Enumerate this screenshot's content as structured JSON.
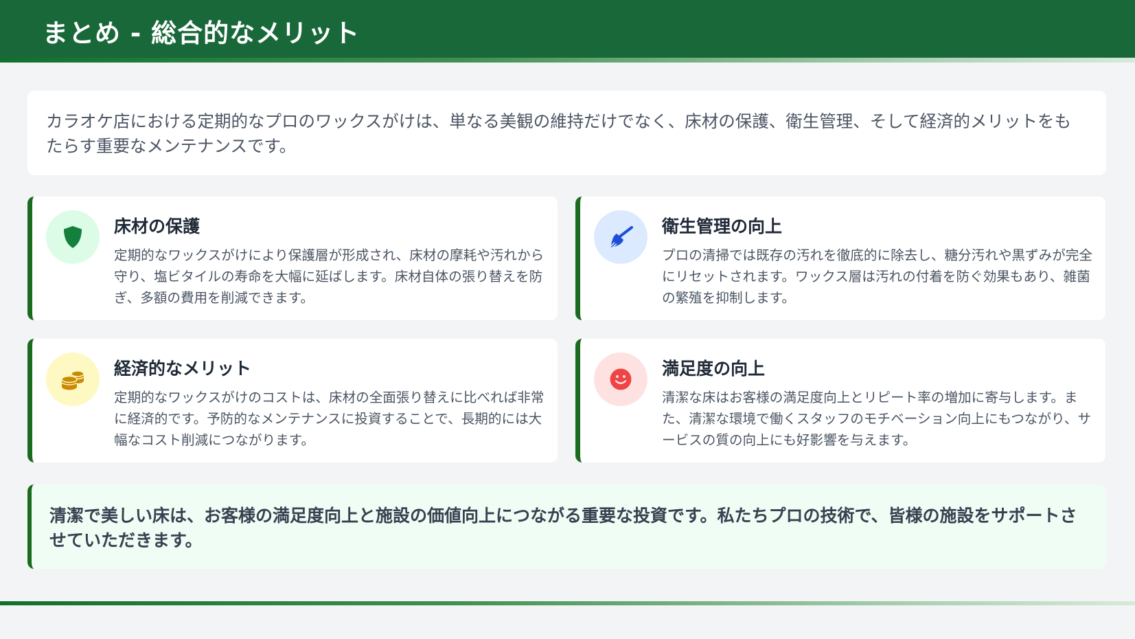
{
  "header": {
    "title": "まとめ - 総合的なメリット"
  },
  "intro": {
    "text": "カラオケ店における定期的なプロのワックスがけは、単なる美観の維持だけでなく、床材の保護、衛生管理、そして経済的メリットをもたらす重要なメンテナンスです。"
  },
  "cards": [
    {
      "title": "床材の保護",
      "text": "定期的なワックスがけにより保護層が形成され、床材の摩耗や汚れから守り、塩ビタイルの寿命を大幅に延ばします。床材自体の張り替えを防ぎ、多額の費用を削減できます。",
      "icon": "shield-icon",
      "icon_color": "#15803d",
      "icon_bg": "#dcfce7"
    },
    {
      "title": "衛生管理の向上",
      "text": "プロの清掃では既存の汚れを徹底的に除去し、糖分汚れや黒ずみが完全にリセットされます。ワックス層は汚れの付着を防ぐ効果もあり、雑菌の繁殖を抑制します。",
      "icon": "broom-icon",
      "icon_color": "#1d4ed8",
      "icon_bg": "#dbeafe"
    },
    {
      "title": "経済的なメリット",
      "text": "定期的なワックスがけのコストは、床材の全面張り替えに比べれば非常に経済的です。予防的なメンテナンスに投資することで、長期的には大幅なコスト削減につながります。",
      "icon": "coins-icon",
      "icon_color": "#ca8a04",
      "icon_bg": "#fef9c3"
    },
    {
      "title": "満足度の向上",
      "text": "清潔な床はお客様の満足度向上とリピート率の増加に寄与します。また、清潔な環境で働くスタッフのモチベーション向上にもつながり、サービスの質の向上にも好影響を与えます。",
      "icon": "smile-icon",
      "icon_color": "#ef4444",
      "icon_bg": "#fee2e2"
    }
  ],
  "closing": {
    "text": "清潔で美しい床は、お客様の満足度向上と施設の価値向上につながる重要な投資です。私たちプロの技術で、皆様の施設をサポートさせていただきます。"
  },
  "colors": {
    "header_bg": "#19683a",
    "accent": "#1a6b1f",
    "page_bg": "#f3f4f6",
    "closing_bg": "#f0fdf4"
  }
}
